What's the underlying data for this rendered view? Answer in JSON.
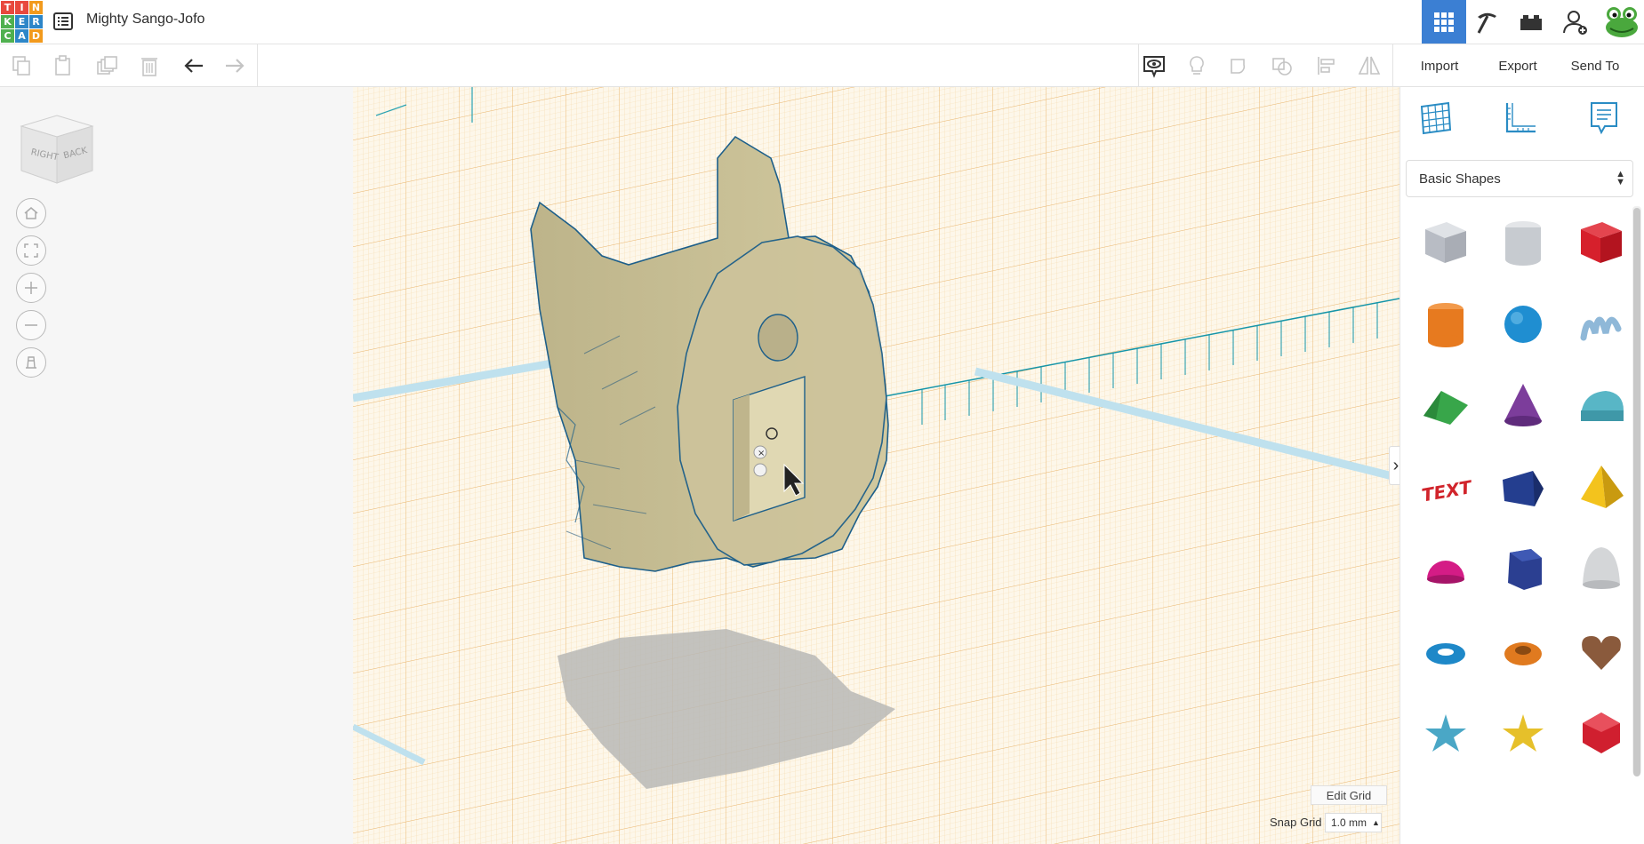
{
  "app": {
    "design_title": "Mighty Sango-Jofo",
    "logo_letters": [
      "T",
      "I",
      "N",
      "K",
      "E",
      "R",
      "C",
      "A",
      "D"
    ],
    "logo_colors": [
      "#e8483d",
      "#e8483d",
      "#f29a1d",
      "#4fb04f",
      "#2d86c8",
      "#2d86c8",
      "#4fb04f",
      "#2d86c8",
      "#f29a1d"
    ]
  },
  "toolbar": {
    "import_label": "Import",
    "export_label": "Export",
    "send_to_label": "Send To"
  },
  "viewcube": {
    "right_label": "RIGHT",
    "back_label": "BACK"
  },
  "workplane": {
    "edit_grid_label": "Edit Grid",
    "snap_grid_label": "Snap Grid",
    "snap_grid_value": "1.0 mm"
  },
  "shapes_panel": {
    "category": "Basic Shapes",
    "shapes": [
      {
        "name": "box-hole",
        "color": "#b8bcc4"
      },
      {
        "name": "cylinder-hole",
        "color": "#c7cbd0"
      },
      {
        "name": "box",
        "color": "#d6202c"
      },
      {
        "name": "cylinder",
        "color": "#e77a1f"
      },
      {
        "name": "sphere",
        "color": "#1f8ed1"
      },
      {
        "name": "scribble",
        "color": "#8fb8d8"
      },
      {
        "name": "roof",
        "color": "#38a64a"
      },
      {
        "name": "cone",
        "color": "#7c3d9b"
      },
      {
        "name": "round-roof",
        "color": "#58b6c6"
      },
      {
        "name": "text",
        "color": "#d1242b"
      },
      {
        "name": "wedge",
        "color": "#243e8f"
      },
      {
        "name": "pyramid",
        "color": "#f3c31d"
      },
      {
        "name": "half-sphere",
        "color": "#d41c86"
      },
      {
        "name": "polygon",
        "color": "#2b3f91"
      },
      {
        "name": "paraboloid",
        "color": "#d4d6d8"
      },
      {
        "name": "torus",
        "color": "#1e88c8"
      },
      {
        "name": "tube",
        "color": "#e07a1f"
      },
      {
        "name": "heart",
        "color": "#8a5a3c"
      },
      {
        "name": "star",
        "color": "#4aa7c6"
      },
      {
        "name": "star-gold",
        "color": "#e6c02a"
      },
      {
        "name": "icosahedron",
        "color": "#d01f2f"
      }
    ]
  },
  "colors": {
    "accent": "#3b7fd3",
    "grid_minor": "#f7d9a6",
    "grid_major": "#e9b46a",
    "model": "#cfc49a",
    "model_edge": "#1d5f8a"
  }
}
